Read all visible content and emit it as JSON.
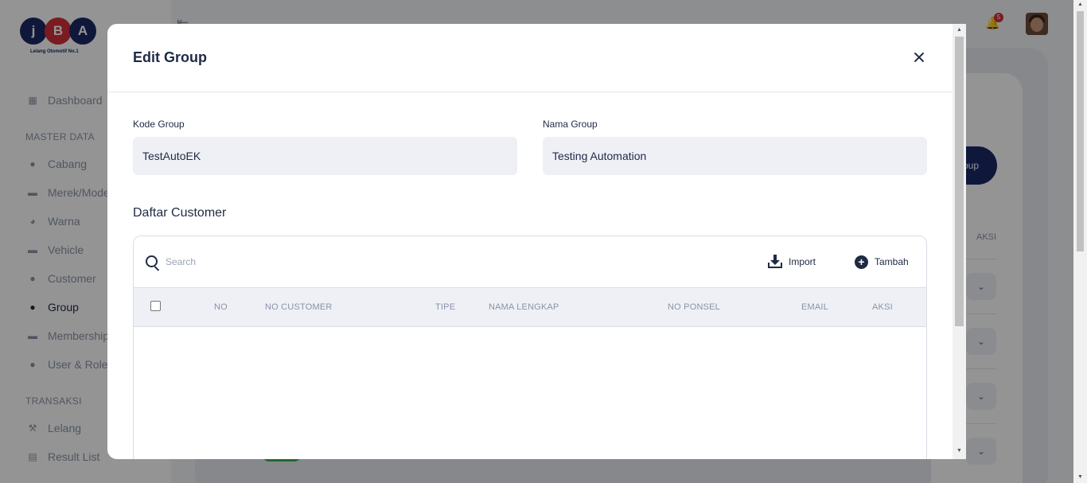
{
  "sidebar": {
    "logo": {
      "letters": [
        "j",
        "B",
        "A"
      ],
      "tagline": "Lelang Otomotif No.1"
    },
    "items_top": [
      {
        "label": "Dashboard",
        "icon": "dashboard-icon"
      }
    ],
    "section_master": "MASTER DATA",
    "items_master": [
      {
        "label": "Cabang",
        "icon": "location-pin-icon"
      },
      {
        "label": "Merek/Model",
        "icon": "car-icon"
      },
      {
        "label": "Warna",
        "icon": "palette-icon"
      },
      {
        "label": "Vehicle",
        "icon": "car-icon"
      },
      {
        "label": "Customer",
        "icon": "user-icon"
      },
      {
        "label": "Group",
        "icon": "users-icon",
        "active": true
      },
      {
        "label": "Membership",
        "icon": "car-icon"
      },
      {
        "label": "User & Role",
        "icon": "user-cog-icon"
      }
    ],
    "section_transaksi": "TRANSAKSI",
    "items_transaksi": [
      {
        "label": "Lelang",
        "icon": "gavel-icon"
      },
      {
        "label": "Result List",
        "icon": "list-icon"
      }
    ]
  },
  "topbar": {
    "notification_count": "5"
  },
  "background": {
    "primary_button_partial": "roup",
    "aksi_header": "AKSI"
  },
  "modal": {
    "title": "Edit Group",
    "kode_group": {
      "label": "Kode Group",
      "value": "TestAutoEK"
    },
    "nama_group": {
      "label": "Nama Group",
      "value": "Testing Automation"
    },
    "section_title": "Daftar Customer",
    "search_placeholder": "Search",
    "import_label": "Import",
    "tambah_label": "Tambah",
    "columns": [
      "NO",
      "NO CUSTOMER",
      "TIPE",
      "NAMA LENGKAP",
      "NO PONSEL",
      "EMAIL",
      "AKSI"
    ],
    "rows": []
  },
  "colors": {
    "brand_navy": "#1b2a66",
    "brand_red": "#d32f3a",
    "overlay": "rgba(0,0,0,0.42)"
  }
}
